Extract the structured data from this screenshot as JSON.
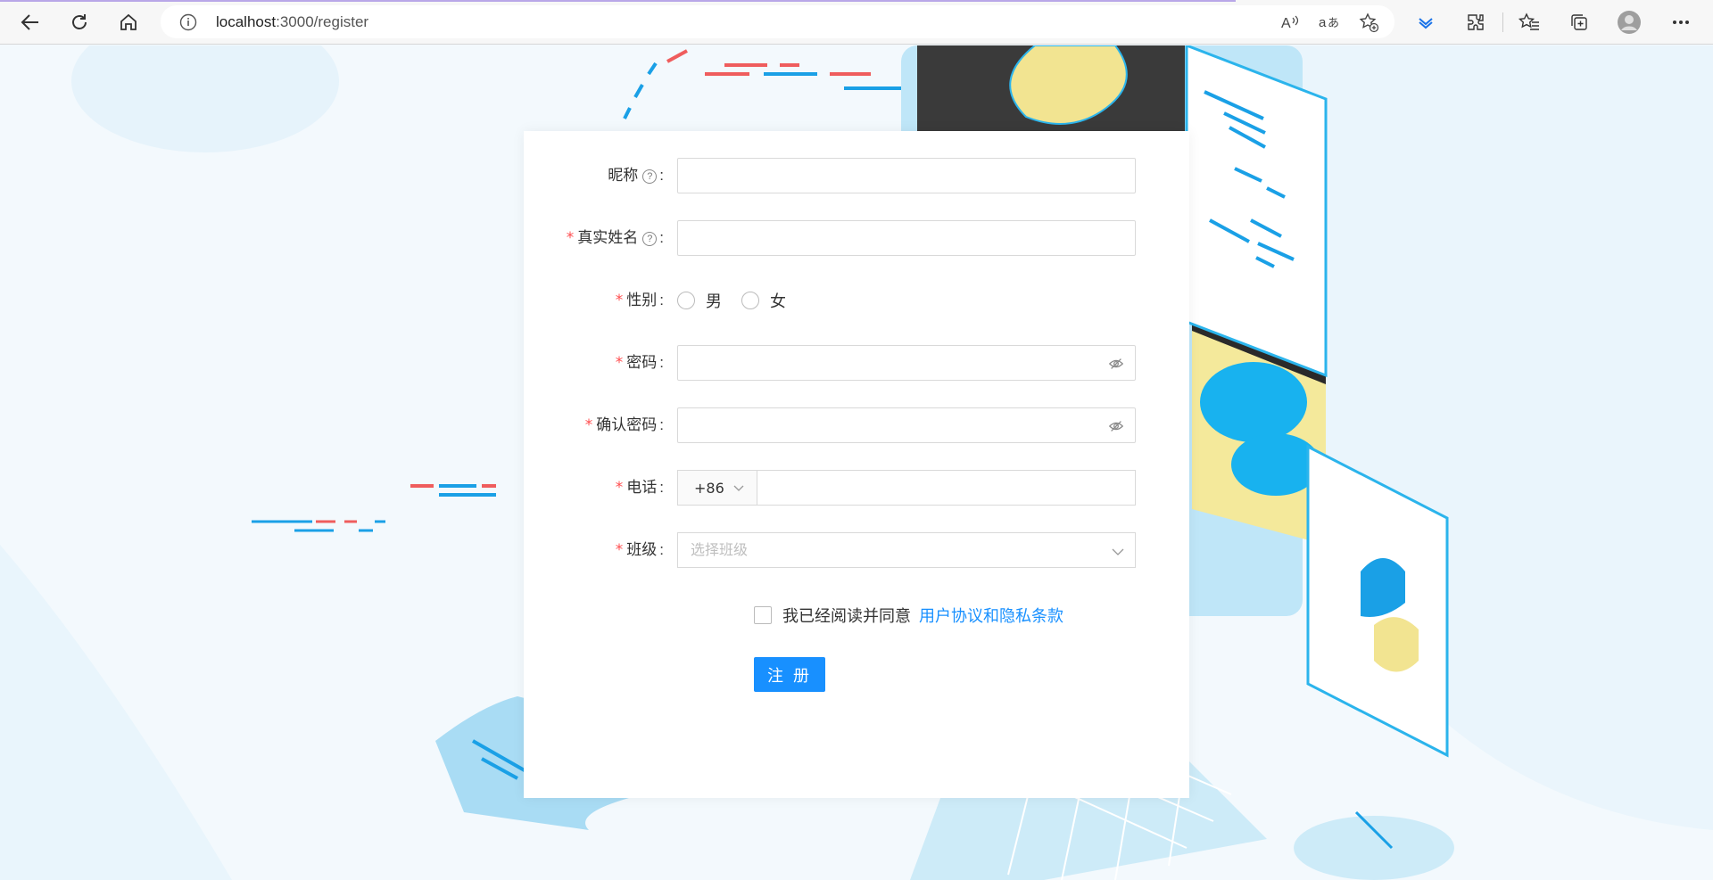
{
  "browser": {
    "url_host": "localhost",
    "url_rest": ":3000/register"
  },
  "form": {
    "nickname_label": "昵称",
    "realname_label": "真实姓名",
    "gender_label": "性别",
    "gender_options": [
      "男",
      "女"
    ],
    "password_label": "密码",
    "confirm_password_label": "确认密码",
    "phone_label": "电话",
    "phone_prefix": "+86",
    "class_label": "班级",
    "class_placeholder": "选择班级",
    "agree_text": "我已经阅读并同意",
    "agree_link": "用户协议和隐私条款",
    "submit_label": "注 册",
    "required_mark": "*",
    "help_mark": "?",
    "colon": ":"
  },
  "colors": {
    "primary": "#1890ff",
    "required": "#ff4d4f"
  },
  "icons": [
    "back-icon",
    "refresh-icon",
    "home-icon",
    "info-icon",
    "read-aloud-icon",
    "translate-icon",
    "favorite-add-icon",
    "download-icon",
    "extensions-icon",
    "favorites-icon",
    "collections-icon",
    "profile-avatar",
    "more-icon",
    "eye-invisible-icon",
    "chevron-down-icon",
    "question-circle-icon"
  ]
}
